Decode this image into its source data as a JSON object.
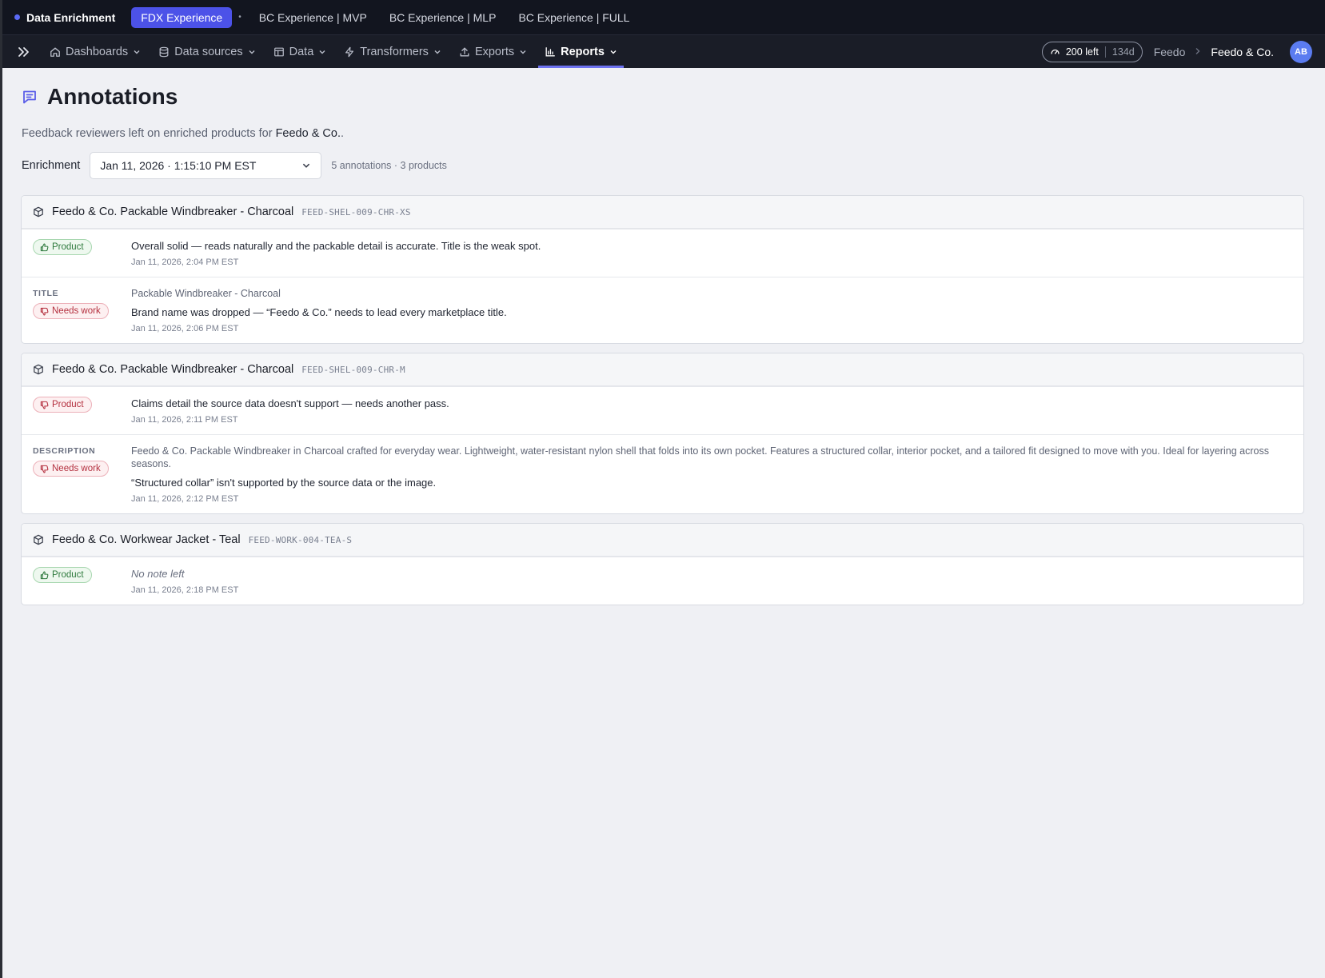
{
  "app": {
    "name": "Data Enrichment"
  },
  "workspace_tabs": [
    {
      "label": "FDX Experience",
      "active": true
    },
    {
      "label": "BC Experience | MVP",
      "active": false
    },
    {
      "label": "BC Experience | MLP",
      "active": false
    },
    {
      "label": "BC Experience | FULL",
      "active": false
    }
  ],
  "workspace_separator": "•",
  "nav": {
    "items": [
      {
        "label": "Dashboards",
        "icon": "home-icon"
      },
      {
        "label": "Data sources",
        "icon": "database-icon"
      },
      {
        "label": "Data",
        "icon": "table-icon"
      },
      {
        "label": "Transformers",
        "icon": "bolt-icon"
      },
      {
        "label": "Exports",
        "icon": "upload-icon"
      },
      {
        "label": "Reports",
        "icon": "bar-chart-icon",
        "active": true
      }
    ],
    "credits_left": "200 left",
    "credits_days": "134d",
    "org_parent": "Feedo",
    "org_current": "Feedo & Co.",
    "avatar_initials": "AB"
  },
  "page": {
    "title": "Annotations",
    "subtitle_prefix": "Feedback reviewers left on enriched products for ",
    "subtitle_org": "Feedo & Co.",
    "subtitle_suffix": ".",
    "filter_label": "Enrichment",
    "filter_value": "Jan 11, 2026 · 1:15:10 PM EST",
    "summary": "5 annotations · 3 products"
  },
  "products": [
    {
      "name": "Feedo & Co. Packable Windbreaker - Charcoal",
      "sku": "FEED-SHEL-009-CHR-XS",
      "annotations": [
        {
          "field_label": "",
          "badge": "Product",
          "sentiment": "good",
          "field_value": "",
          "note": "Overall solid — reads naturally and the packable detail is accurate. Title is the weak spot.",
          "timestamp": "Jan 11, 2026, 2:04 PM EST"
        },
        {
          "field_label": "TITLE",
          "badge": "Needs work",
          "sentiment": "bad",
          "field_value": "Packable Windbreaker - Charcoal",
          "note": "Brand name was dropped — “Feedo & Co.” needs to lead every marketplace title.",
          "timestamp": "Jan 11, 2026, 2:06 PM EST"
        }
      ]
    },
    {
      "name": "Feedo & Co. Packable Windbreaker - Charcoal",
      "sku": "FEED-SHEL-009-CHR-M",
      "annotations": [
        {
          "field_label": "",
          "badge": "Product",
          "sentiment": "bad",
          "field_value": "",
          "note": "Claims detail the source data doesn't support — needs another pass.",
          "timestamp": "Jan 11, 2026, 2:11 PM EST"
        },
        {
          "field_label": "DESCRIPTION",
          "badge": "Needs work",
          "sentiment": "bad",
          "field_value": "Feedo & Co. Packable Windbreaker in Charcoal crafted for everyday wear. Lightweight, water-resistant nylon shell that folds into its own pocket. Features a structured collar, interior pocket, and a tailored fit designed to move with you. Ideal for layering across seasons.",
          "note": "“Structured collar” isn't supported by the source data or the image.",
          "timestamp": "Jan 11, 2026, 2:12 PM EST"
        }
      ]
    },
    {
      "name": "Feedo & Co. Workwear Jacket - Teal",
      "sku": "FEED-WORK-004-TEA-S",
      "annotations": [
        {
          "field_label": "",
          "badge": "Product",
          "sentiment": "good",
          "field_value": "",
          "note": "No note left",
          "note_empty": true,
          "timestamp": "Jan 11, 2026, 2:18 PM EST"
        }
      ]
    }
  ],
  "colors": {
    "accent": "#4c52e8",
    "positive": "#2f7a3e",
    "negative": "#b4303f",
    "topbar_bg": "#12151f",
    "navbar_bg": "#1a1d27"
  }
}
